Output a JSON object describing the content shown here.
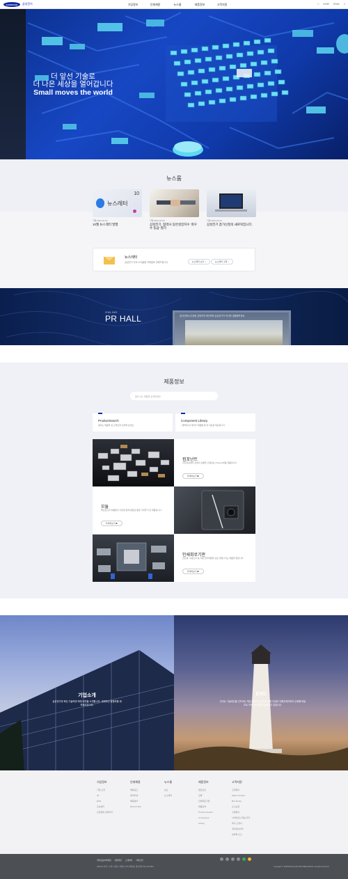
{
  "header": {
    "logo": "SAMSUNG",
    "logo_sub": "삼성전기",
    "nav": [
      "기업정보",
      "인재채용",
      "뉴스룸",
      "제품정보",
      "고객지원"
    ],
    "tools": [
      "KOR",
      "ENG"
    ]
  },
  "hero": {
    "line1": "더 앞선 기술로",
    "line2": "더 나은 세상을 열어갑니다",
    "line3": "Small moves the world"
  },
  "news": {
    "title": "뉴스룸",
    "cards": [
      {
        "thumb_label": "뉴스레터",
        "thumb_num": "10",
        "date": "기업  2021.10.19",
        "title": "10월 뉴스레터 발행"
      },
      {
        "date": "기업  2021.10.18",
        "title": "삼성전기, 협력사 동반성장지수 '최우수 등급' 평가"
      },
      {
        "date": "기업  2021.10.15",
        "title": "삼성전기 참가신청의 새로워집니다."
      }
    ],
    "newsletter": {
      "title": "뉴스레터",
      "desc": "삼성전기 주요 소식들을 이메일로 전해드립니다.",
      "btn1": "뉴스레터 보기 >",
      "btn2": "뉴스레터 구독 >"
    }
  },
  "pr": {
    "online": "ONLINE",
    "title": "PR HALL",
    "desc": "온라인에서 다양한 콘텐츠를 확인하며 삼성전기의 역사를 경험해보세요."
  },
  "products": {
    "title": "제품정보",
    "search_placeholder": "찾으시는 제품을 검색하세요",
    "services": [
      {
        "title": "ProductSearch",
        "desc": "원하는 제품을 쉽고 빠르게 검색해 보세요."
      },
      {
        "title": "Component Library",
        "desc": "시뮬레이션 데이터 제품별 툴 및 자료를 제공합니다."
      }
    ],
    "items": [
      {
        "title": "컴포넌트",
        "desc": "전자회로에서 전류의 흐름을 조절하는 Passive부품 제품입니다.",
        "btn": "자세히보기 ▶"
      },
      {
        "title": "모듈",
        "desc": "메인보드와 부품들이 기판에 함께 결합된 통합 기술을 가진 제품입니다.",
        "btn": "자세히보기 ▶"
      },
      {
        "title": "인쇄회로기판",
        "desc": "반도체, 수동소자 등 각종 전자부품을 상호 연결시키는 제품을 말합니다.",
        "btn": "자세히보기 ▶"
      }
    ]
  },
  "about": {
    "title": "기업소개",
    "desc": "삼성전기의 혁신 기술력과 미래 비전을 소개합니다. 세계적인 종합부품 제조회사입니다."
  },
  "esg": {
    "title": "ESG",
    "desc": "우리는 기술혁신을 선도하는 책임기업으로 인류의 미래 다양한 이해관계자와의 신뢰를 바탕으로 지속가능경영을 실현하고 있습니다."
  },
  "footer": {
    "columns": [
      {
        "head": "기업정보",
        "items": [
          "기업 소개",
          "IR",
          "ESG",
          "홍보센터",
          "인권경영 홈페이지"
        ]
      },
      {
        "head": "인재채용",
        "items": [
          "채용공고",
          "복리후생",
          "채용절차",
          "Recruit Site"
        ]
      },
      {
        "head": "뉴스룸",
        "items": [
          "보도",
          "뉴스레터"
        ]
      },
      {
        "head": "제품정보",
        "items": [
          "컴포넌트",
          "모듈",
          "인쇄회로기판",
          "제품검색",
          "Product Search",
          "Component",
          "Library"
        ]
      },
      {
        "head": "고객지원",
        "items": [
          "고객문의",
          "Sales Contact",
          "Bus Route",
          "오시는길",
          "구매문의",
          "사이버감사 제보 창구",
          "회사 소개서",
          "개인정보처리",
          "반부패 신고"
        ]
      }
    ],
    "bottom_links": [
      "개인정보처리방침",
      "이용약관",
      "고객센터",
      "사이트맵"
    ],
    "info": "(16674) 경기도 수원시 영통구 매영로 150 (매탄동) 대표전화 031-210-5114",
    "copyright": "Copyright © SAMSUNG ELECTRO-MECHANICS. All rights reserved."
  }
}
